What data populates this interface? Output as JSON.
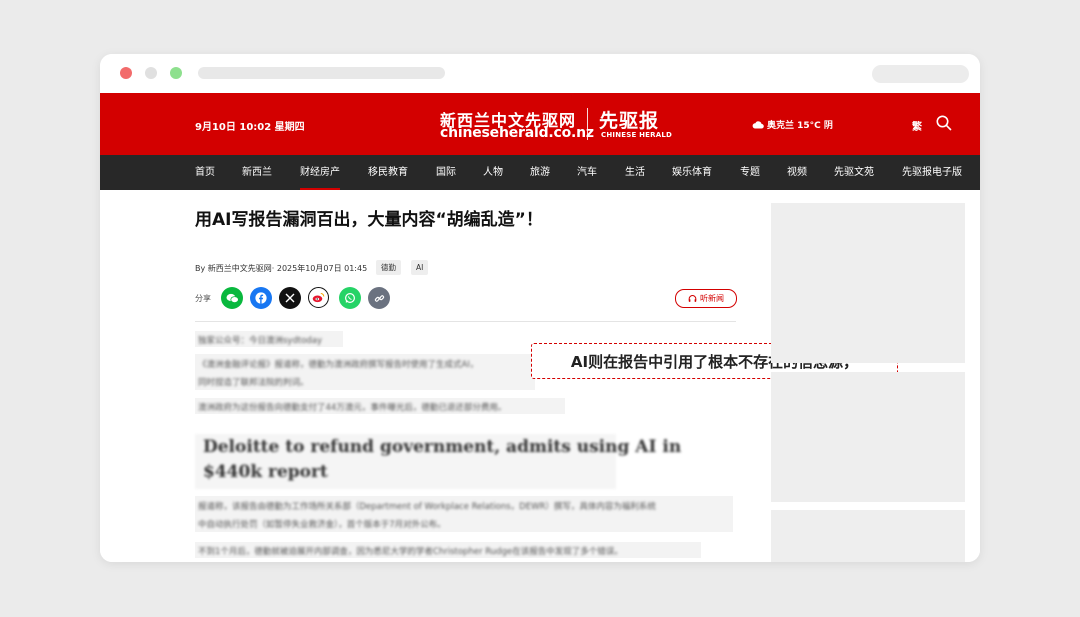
{
  "header": {
    "datetime": "9月10日 10:02  星期四",
    "logo_cn": "新西兰中文先驱网",
    "logo_en": "chineseherald.co.nz",
    "brand_cn": "先驱报",
    "brand_en": "CHINESE HERALD",
    "weather": "奥克兰 15°C 阴",
    "traditional_toggle": "繁"
  },
  "nav": [
    "首页",
    "新西兰",
    "财经房产",
    "移民教育",
    "国际",
    "人物",
    "旅游",
    "汽车",
    "生活",
    "娱乐体育",
    "专题",
    "视频",
    "先驱文苑",
    "先驱报电子版"
  ],
  "nav_active": "财经房产",
  "article": {
    "title": "用AI写报告漏洞百出，大量内容“胡编乱造”！",
    "byline": "By 新西兰中文先驱网· 2025年10月07日 01:45",
    "tags": [
      "德勤",
      "AI"
    ],
    "share_label": "分享",
    "listen_label": "听新闻",
    "body": [
      "独家公众号：今日澳洲sydtoday",
      "《澳洲金融评论报》报道称，德勤为澳洲政府撰写报告时使用了生成式AI，",
      "同时捏造了联邦法院的判词。",
      "澳洲政府为这份报告向德勤支付了44万澳元，事件曝光后，德勤已退还部分费用。",
      "报道称，该报告由德勤为工作场所关系部（Department of Workplace Relations，DEWR）撰写，具体内容为福利系统",
      "中自动执行处罚（如暂停失业救济金），首个版本于7月对外公布。",
      "不到1个月后，德勤就被迫展开内部调查，因为悉尼大学的学者Christopher Rudge在该报告中发现了多个错误。"
    ],
    "quote": [
      "Deloitte to refund government, admits using AI in",
      "$440k report"
    ]
  },
  "callout": "AI则在报告中引用了根本不存在的信息源，",
  "colors": {
    "brand_red": "#d30000",
    "nav_bg": "#282828",
    "wechat": "#09b83e",
    "facebook": "#1877f2",
    "x": "#111111",
    "whatsapp": "#25d366",
    "link": "#6b7280"
  }
}
